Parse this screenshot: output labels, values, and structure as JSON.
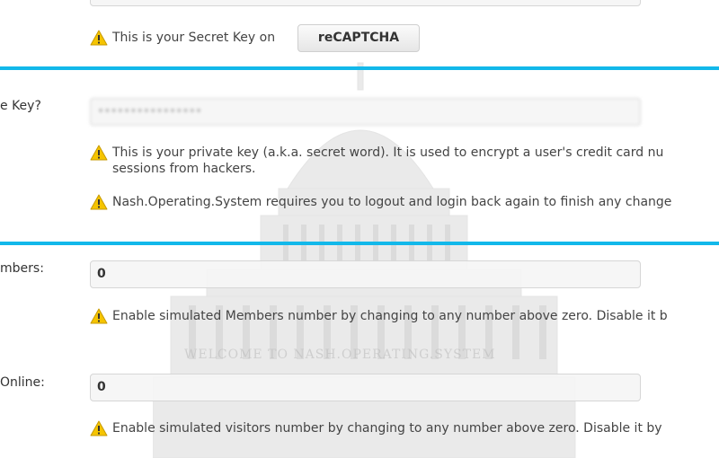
{
  "secret_key_section": {
    "note": "This is your Secret Key on",
    "recaptcha_button": "reCAPTCHA"
  },
  "private_key_section": {
    "label": "e Key?",
    "value": "••••••••••••••••",
    "note_line1": "This is your private key (a.k.a. secret word). It is used to encrypt a user's credit card nu",
    "note_line2": "sessions from hackers.",
    "note2": "Nash.Operating.System requires you to logout and login back again to finish any change"
  },
  "members_section": {
    "label": "mbers:",
    "value": "0",
    "note": "Enable simulated Members number by changing to any number above zero. Disable it b"
  },
  "online_section": {
    "label": "Online:",
    "value": "0",
    "note": "Enable simulated visitors number by changing to any number above zero. Disable it by"
  },
  "background": {
    "banner_text": "WELCOME TO NASH.OPERATING.SYSTEM"
  },
  "colors": {
    "divider": "#12b8ea",
    "warning_fill": "#f5c400",
    "text": "#444444"
  },
  "icons": {
    "warning": "warning-icon"
  }
}
